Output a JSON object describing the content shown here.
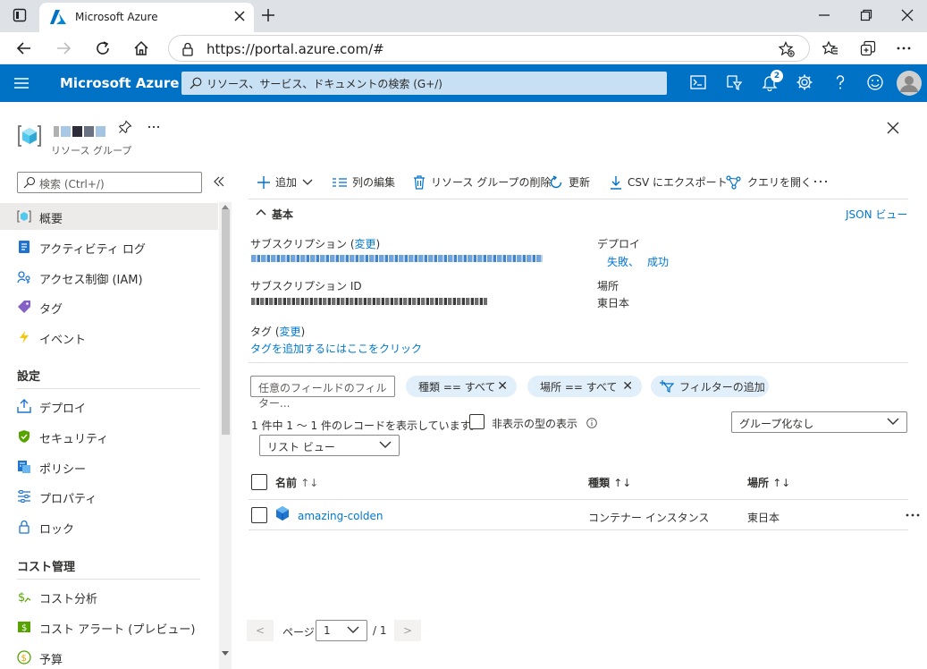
{
  "browser": {
    "tab_title": "Microsoft Azure",
    "url": "https://portal.azure.com/#"
  },
  "azure": {
    "brand": "Microsoft Azure",
    "search_placeholder": "リソース、サービス、ドキュメントの検索 (G+/)",
    "notification_count": "2"
  },
  "resource": {
    "type_label": "リソース グループ"
  },
  "sidebar": {
    "search_placeholder": "検索 (Ctrl+/)",
    "items": [
      {
        "label": "概要"
      },
      {
        "label": "アクティビティ ログ"
      },
      {
        "label": "アクセス制御 (IAM)"
      },
      {
        "label": "タグ"
      },
      {
        "label": "イベント"
      }
    ],
    "section_settings": "設定",
    "settings_items": [
      {
        "label": "デプロイ"
      },
      {
        "label": "セキュリティ"
      },
      {
        "label": "ポリシー"
      },
      {
        "label": "プロパティ"
      },
      {
        "label": "ロック"
      }
    ],
    "section_cost": "コスト管理",
    "cost_items": [
      {
        "label": "コスト分析"
      },
      {
        "label": "コスト アラート (プレビュー)"
      },
      {
        "label": "予算"
      }
    ]
  },
  "commands": {
    "add": "追加",
    "edit_columns": "列の編集",
    "delete_rg": "リソース グループの削除",
    "refresh": "更新",
    "export_csv": "CSV にエクスポート",
    "open_query": "クエリを開く"
  },
  "essentials": {
    "header": "基本",
    "json_view": "JSON ビュー",
    "subscription_label": "サブスクリプション",
    "change": "変更",
    "subscription_id_label": "サブスクリプション ID",
    "deploy_label": "デプロイ",
    "deploy_failed": "失敗",
    "deploy_success": "成功",
    "location_label": "場所",
    "location_value": "東日本",
    "tags_label": "タグ",
    "add_tags_link": "タグを追加するにはここをクリック"
  },
  "filters": {
    "field_filter_placeholder": "任意のフィールドのフィルター...",
    "type_pill": "種類 == すべて",
    "location_pill": "場所 == すべて",
    "add_filter": "フィルターの追加"
  },
  "list": {
    "record_count": "1 件中 1 ～ 1 件のレコードを表示しています。",
    "show_hidden_types": "非表示の型の表示",
    "grouping": "グループ化なし",
    "view": "リスト ビュー"
  },
  "table": {
    "columns": [
      "名前",
      "種類",
      "場所"
    ],
    "rows": [
      {
        "name": "amazing-colden",
        "type": "コンテナー インスタンス",
        "location": "東日本"
      }
    ]
  },
  "pagination": {
    "prev": "<",
    "page_label": "ページ",
    "page_value": "1",
    "total": "/ 1",
    "next": ">"
  },
  "colors": {
    "azure_blue": "#0072c6",
    "link": "#0078d4",
    "pill_bg": "#e1effa"
  }
}
